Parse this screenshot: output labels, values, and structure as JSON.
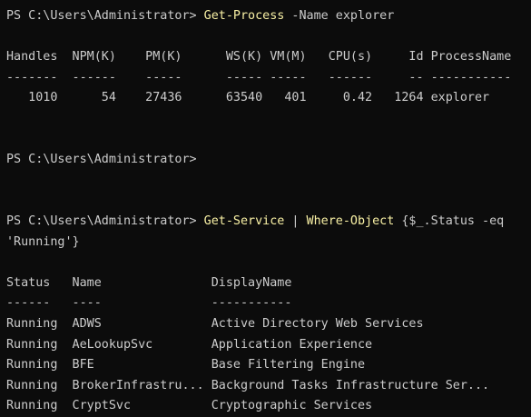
{
  "prompt": "PS C:\\Users\\Administrator> ",
  "cmd1": {
    "cmdlet": "Get-Process",
    "param": " -Name",
    "arg": " explorer"
  },
  "process_table": {
    "header": "Handles  NPM(K)    PM(K)      WS(K) VM(M)   CPU(s)     Id ProcessName",
    "separator": "-------  ------    -----      ----- -----   ------     -- -----------",
    "rows": [
      "   1010      54    27436      63540   401     0.42   1264 explorer"
    ]
  },
  "cmd3": {
    "cmdlet1": "Get-Service",
    "pipe": " | ",
    "cmdlet2": "Where-Object",
    "block_start": " {$_.Status -eq",
    "block_end": "'Running'}"
  },
  "service_table": {
    "header": "Status   Name               DisplayName",
    "separator": "------   ----               -----------",
    "rows": [
      "Running  ADWS               Active Directory Web Services",
      "Running  AeLookupSvc        Application Experience",
      "Running  BFE                Base Filtering Engine",
      "Running  BrokerInfrastru... Background Tasks Infrastructure Ser...",
      "Running  CryptSvc           Cryptographic Services"
    ]
  },
  "colors": {
    "background": "#0c0c0c",
    "foreground": "#cccccc",
    "cmdlet": "#f9f1a5"
  }
}
